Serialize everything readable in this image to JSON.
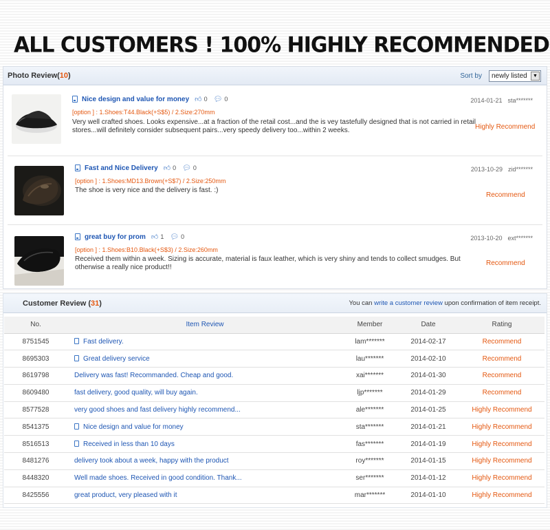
{
  "banner": {
    "text": "ALL CUSTOMERS ! 100% HIGHLY RECOMMENDED"
  },
  "photo_review": {
    "title": "Photo Review",
    "count_open": "(",
    "count": "10",
    "count_close": ")",
    "sort_label": "Sort by",
    "sort_value": "newly listed",
    "reviews": [
      {
        "title": "Nice design and value for money",
        "likes": "0",
        "comments": "0",
        "option": "[option ] : 1.Shoes:T44.Black(+S$5) / 2.Size:270mm",
        "text": "Very well crafted shoes. Looks expensive...at a fraction of the retail cost...and the is vey tastefully designed that is not carried in retail stores...will definitely consider subsequent pairs...very speedy delivery too...within 2 weeks.",
        "date": "2014-01-21",
        "member": "sta*******",
        "rating": "Highly Recommend"
      },
      {
        "title": "Fast and Nice Delivery",
        "likes": "0",
        "comments": "0",
        "option": "[option ] : 1.Shoes:MD13.Brown(+S$7) / 2.Size:250mm",
        "text": "The shoe is very nice and the delivery is fast. :)",
        "date": "2013-10-29",
        "member": "zid*******",
        "rating": "Recommend"
      },
      {
        "title": "great buy for prom",
        "likes": "1",
        "comments": "0",
        "option": "[option ] : 1.Shoes:B10.Black(+S$3) / 2.Size:260mm",
        "text": "Received them within a week. Sizing is accurate, material is faux leather, which is very shiny and tends to collect smudges. But otherwise a really nice product!!",
        "date": "2013-10-20",
        "member": "ext*******",
        "rating": "Recommend"
      }
    ]
  },
  "customer_review": {
    "title": "Customer Review",
    "count_open": "(",
    "count": "31",
    "count_close": ")",
    "note_prefix": "You can",
    "note_link": "write a customer review",
    "note_suffix": "upon confirmation of item receipt.",
    "columns": [
      "No.",
      "Item Review",
      "Member",
      "Date",
      "Rating"
    ],
    "rows": [
      {
        "no": "8751545",
        "review": "Fast delivery.",
        "has_icon": true,
        "member": "lam*******",
        "date": "2014-02-17",
        "rating": "Recommend"
      },
      {
        "no": "8695303",
        "review": "Great delivery service",
        "has_icon": true,
        "member": "lau*******",
        "date": "2014-02-10",
        "rating": "Recommend"
      },
      {
        "no": "8619798",
        "review": "Delivery was fast! Recommanded. Cheap and good.",
        "has_icon": false,
        "member": "xai*******",
        "date": "2014-01-30",
        "rating": "Recommend"
      },
      {
        "no": "8609480",
        "review": "fast delivery, good quality, will buy again.",
        "has_icon": false,
        "member": "ljp*******",
        "date": "2014-01-29",
        "rating": "Recommend"
      },
      {
        "no": "8577528",
        "review": "very good shoes and fast delivery highly recommend...",
        "has_icon": false,
        "member": "ale*******",
        "date": "2014-01-25",
        "rating": "Highly Recommend"
      },
      {
        "no": "8541375",
        "review": "Nice design and value for money",
        "has_icon": true,
        "member": "sta*******",
        "date": "2014-01-21",
        "rating": "Highly Recommend"
      },
      {
        "no": "8516513",
        "review": "Received in less than 10 days",
        "has_icon": true,
        "member": "fas*******",
        "date": "2014-01-19",
        "rating": "Highly Recommend"
      },
      {
        "no": "8481276",
        "review": "delivery took about a week, happy with the product",
        "has_icon": false,
        "member": "roy*******",
        "date": "2014-01-15",
        "rating": "Highly Recommend"
      },
      {
        "no": "8448320",
        "review": "Well made shoes. Received in good condition. Thank...",
        "has_icon": false,
        "member": "ser*******",
        "date": "2014-01-12",
        "rating": "Highly Recommend"
      },
      {
        "no": "8425556",
        "review": "great product, very pleased with it",
        "has_icon": false,
        "member": "mar*******",
        "date": "2014-01-10",
        "rating": "Highly Recommend"
      }
    ]
  },
  "colors": {
    "accent": "#e4570f",
    "link": "#1e56b3"
  }
}
